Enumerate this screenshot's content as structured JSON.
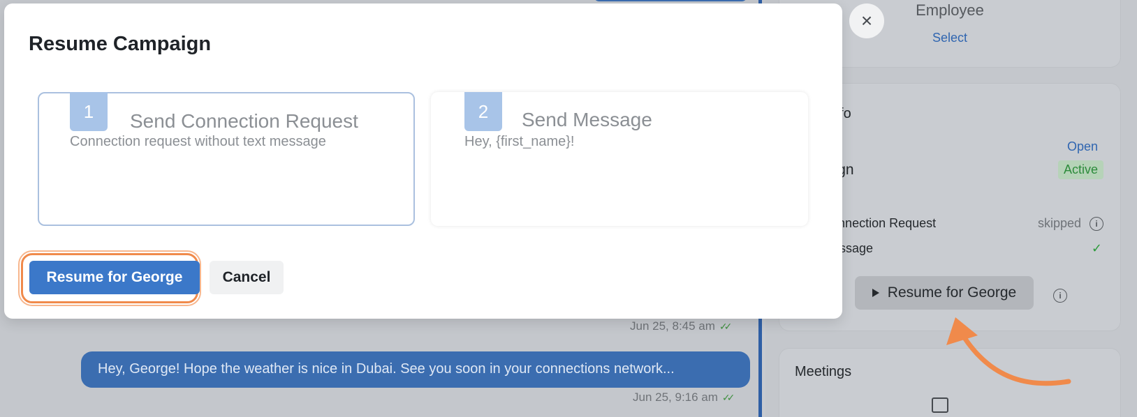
{
  "modal": {
    "title": "Resume Campaign",
    "steps": [
      {
        "number": "1",
        "title": "Send Connection Request",
        "description": "Connection request without text message"
      },
      {
        "number": "2",
        "title": "Send Message",
        "description": "Hey, {first_name}!"
      }
    ],
    "primary_button": "Resume for George",
    "cancel_button": "Cancel",
    "close_icon": "×"
  },
  "chat": {
    "messages": [
      {
        "time": "Jun 25, 8:45 am"
      },
      {
        "text": "Hey, George! Hope the weather is nice in Dubai. See you soon in your connections network...",
        "time": "Jun 25, 9:16 am"
      }
    ],
    "ticks": "✓✓"
  },
  "sidebar": {
    "employee": {
      "title": "Employee",
      "select_link": "Select"
    },
    "campaign_info": {
      "heading": "aign Info",
      "open_link": "Open",
      "campaign_name": "ampaign",
      "status": "Active",
      "steps": [
        {
          "label": "end Connection Request",
          "status": "skipped"
        },
        {
          "label": "end Message",
          "status": "✓"
        }
      ],
      "resume_button": "Resume for George",
      "info_glyph": "i"
    },
    "meetings": {
      "heading": "Meetings"
    }
  },
  "colors": {
    "primary": "#3b78c9",
    "highlight": "#f08a4b",
    "active_green": "#2c8b3b"
  }
}
